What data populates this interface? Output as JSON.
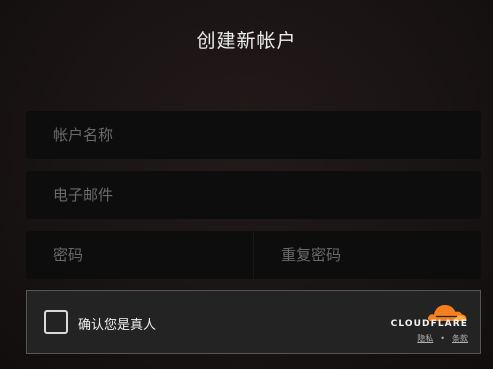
{
  "page": {
    "title": "创建新帐户"
  },
  "form": {
    "username_placeholder": "帐户名称",
    "email_placeholder": "电子邮件",
    "password_placeholder": "密码",
    "confirm_password_placeholder": "重复密码"
  },
  "captcha": {
    "checkbox_label": "确认您是真人",
    "checked": false,
    "brand_text": "CLOUDFLARE",
    "privacy_link": "隐私",
    "separator": "•",
    "terms_link": "条款",
    "brand_color": "#f38020",
    "brand_icon": "cloudflare-cloud-icon"
  }
}
